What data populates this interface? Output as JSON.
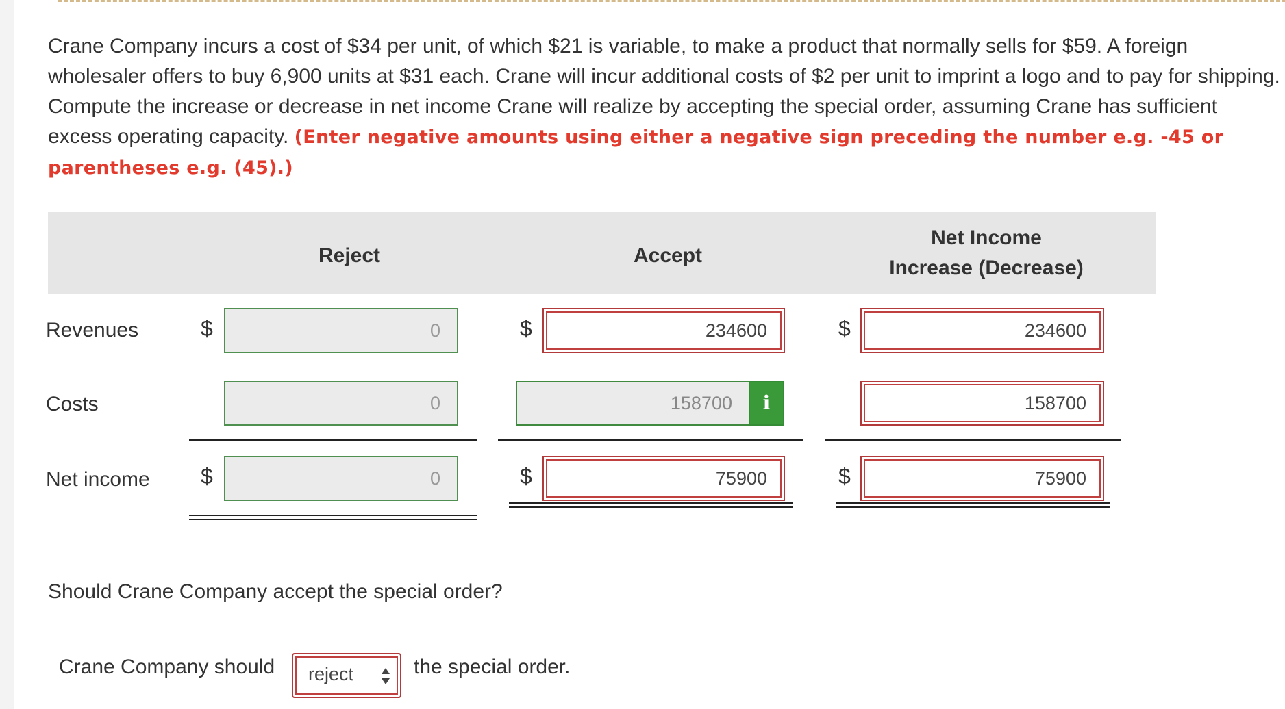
{
  "problem": {
    "text": "Crane Company incurs a cost of $34 per unit, of which $21 is variable, to make a product that normally sells for $59. A foreign wholesaler offers to buy 6,900 units at $31 each. Crane will incur additional costs of $2 per unit to imprint a logo and to pay for shipping. Compute the increase or decrease in net income Crane will realize by accepting the special order, assuming Crane has sufficient excess operating capacity.",
    "hint": "(Enter negative amounts using either a negative sign preceding the number e.g. -45 or parentheses e.g. (45).)"
  },
  "table": {
    "headers": {
      "reject": "Reject",
      "accept": "Accept",
      "net_line1": "Net Income",
      "net_line2": "Increase (Decrease)"
    },
    "currency_symbol": "$",
    "rows": {
      "revenues": {
        "label": "Revenues",
        "reject": "0",
        "accept": "234600",
        "net": "234600"
      },
      "costs": {
        "label": "Costs",
        "reject": "0",
        "accept": "158700",
        "net": "158700"
      },
      "net_income": {
        "label": "Net income",
        "reject": "0",
        "accept": "75900",
        "net": "75900"
      }
    },
    "info_button_glyph": "i"
  },
  "decision": {
    "question": "Should Crane Company accept the special order?",
    "prefix": "Crane Company should",
    "selected": "reject",
    "suffix": "the special order."
  },
  "colors": {
    "hint_red": "#e23a2c",
    "error_border": "#b23a3a",
    "correct_border": "#4f8f4f",
    "info_green": "#3a9a3a",
    "header_band": "#e6e6e6"
  }
}
